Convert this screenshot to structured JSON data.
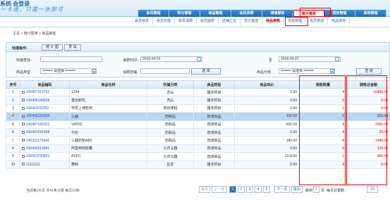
{
  "header": {
    "brand": "系统 会登录",
    "slogan": "一卡通，只需一张即可",
    "main_nav": [
      "会员管理",
      "积分管理",
      "商品管理",
      "会员消费",
      "增值服务",
      "统计报表",
      "短信管理",
      "系统管理"
    ],
    "active_main": 5,
    "sub_nav": [
      "会员信息",
      "会员充值",
      "会员消费",
      "会员提现",
      "店铺汇总",
      "员工提成",
      "商品销售",
      "交班管理",
      "会员变动",
      "商品库存"
    ],
    "active_sub": 6
  },
  "breadcrumb": "主页 > 统计报表 > 商品销售",
  "quick_ops": {
    "label": "快捷操作：",
    "stats_btn": "统 计 图",
    "export_btn": "导 出"
  },
  "filters": {
    "quick_search_label": "快速查找：",
    "quick_search_value": "",
    "category_label": "商品类型：",
    "category_value": "===== 请选择 =====",
    "time_label": "消费时间：",
    "time_from": "2016-04-01",
    "time_to": "2016-04-21",
    "time_sep": "至",
    "shop_label": "消费店铺：",
    "shop_value": "",
    "select_btn": "选 择",
    "goods_cat_label": "商品分类：",
    "goods_cat_value": "===== 请选择 =====",
    "query_btn": "查 询"
  },
  "table": {
    "columns": [
      "序号",
      "商品编码",
      "商品名称",
      "所属分类",
      "商品类型",
      "商品单价",
      "销售数量",
      "销售总金额"
    ],
    "rows": [
      [
        "1",
        "160407113752",
        "1234",
        "洗头",
        "服务项目",
        "0.00",
        "4",
        "16400.00"
      ],
      [
        "2",
        "160405143035",
        "重伍新吃",
        "洗头",
        "服务项目",
        "0.00",
        "5",
        "0.00"
      ],
      [
        "3",
        "160419111952",
        "学员上课签到",
        "培训课程",
        "服务项目",
        "0.00",
        "1",
        "0.00"
      ],
      [
        "4",
        "160408150936",
        "三鹿",
        "奶制品",
        "普通商品",
        "100.00",
        "2",
        "200.00"
      ],
      [
        "5",
        "160407150321",
        "VIPDD",
        "奶制品",
        "普通商品",
        "500.00",
        "4",
        "2000.00"
      ],
      [
        "6",
        "160401091408",
        "牛奶",
        "奶制品",
        "普通商品",
        "5.00",
        "4",
        "20.00"
      ],
      [
        "7",
        "160331170341",
        "三鹿奶粉AB1",
        "奶制品",
        "普通商品",
        "180.00",
        "8",
        "1440.00"
      ],
      [
        "8",
        "160420113341",
        "阿莫西林胶囊",
        "九农马器",
        "普通商品",
        "0.00",
        "9",
        "120.00"
      ],
      [
        "9",
        "160412230821",
        "ASDC",
        "九农马器",
        "普通商品",
        "1119.00",
        "1",
        "960.00"
      ],
      [
        "10",
        "11111111",
        "舞制",
        "剪发",
        "服务项目",
        "0.00",
        "4",
        "0.00"
      ]
    ],
    "selected_row": 3
  },
  "pager": {
    "info": "当前第1/5页 共41条记录 每页10条",
    "first": "首页",
    "prev": "上一页",
    "pages": [
      "1",
      "2",
      "3",
      "4",
      "5"
    ],
    "current_page": "1",
    "next": "下一页",
    "last": "尾页",
    "jump_label": "跳到",
    "jump_value": "1",
    "page_unit": "页",
    "per_page_label": "每页记录数：",
    "per_page_value": "10"
  },
  "colors": {
    "accent": "#2a73b8",
    "highlight": "#e00000",
    "selected_row": "#b9d6f2"
  }
}
